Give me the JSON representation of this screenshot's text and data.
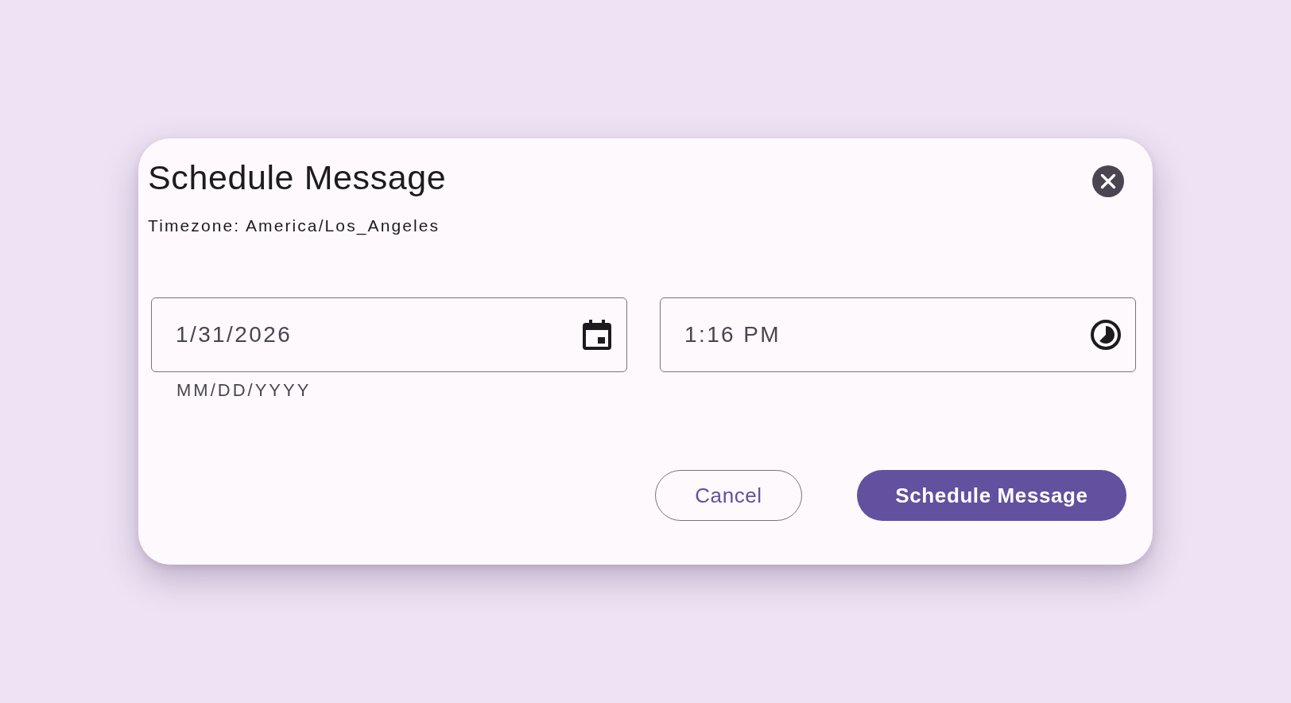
{
  "dialog": {
    "title": "Schedule Message",
    "timezone": "Timezone: America/Los_Angeles"
  },
  "date_field": {
    "value": "1/31/2026",
    "helper": "MM/DD/YYYY"
  },
  "time_field": {
    "value": "1:16 PM"
  },
  "buttons": [
    {
      "label": "Cancel",
      "kind": "outlined"
    },
    {
      "label": "Schedule Message",
      "kind": "filled"
    }
  ]
}
